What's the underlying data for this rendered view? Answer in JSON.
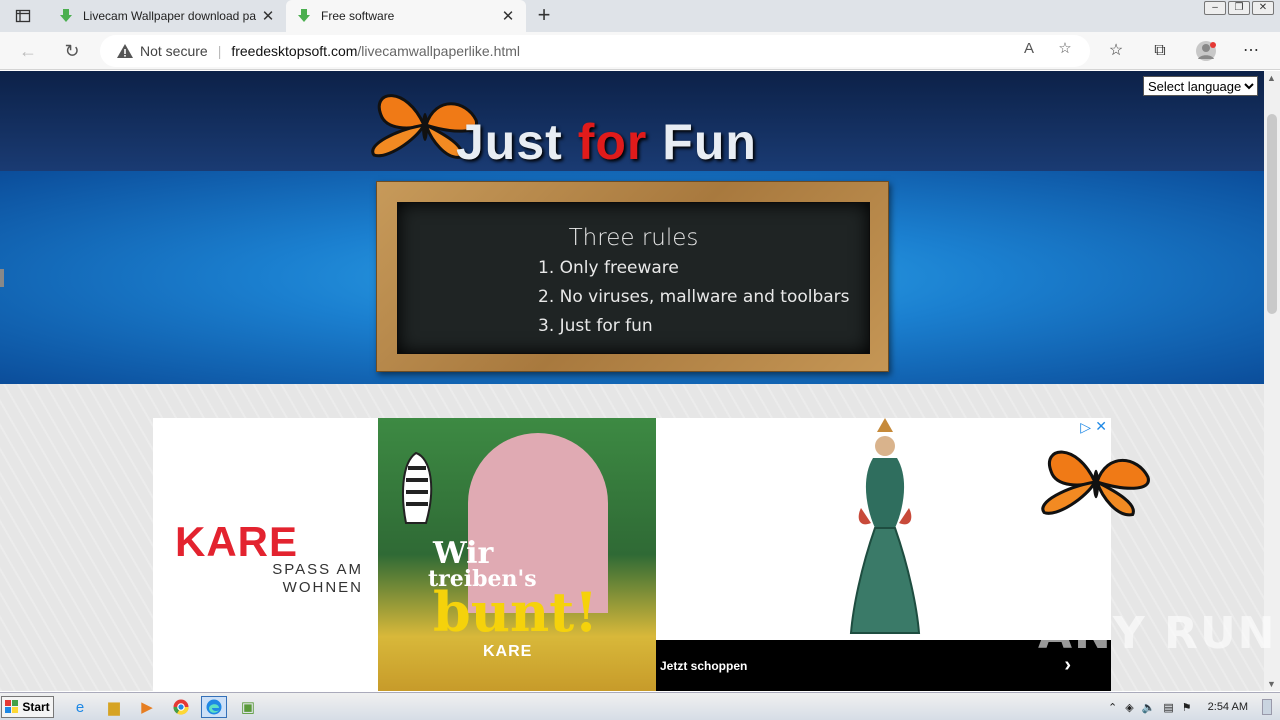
{
  "browser": {
    "tabs": [
      {
        "title": "Livecam Wallpaper download pa",
        "active": false
      },
      {
        "title": "Free software",
        "active": true
      }
    ],
    "address": {
      "security_label": "Not secure",
      "domain": "freedesktopsoft.com",
      "path": "/livecamwallpaperlike.html"
    }
  },
  "page": {
    "site_title_part1": "Just",
    "site_title_part2": "for",
    "site_title_part3": "Fun",
    "language_select": "Select language",
    "board": {
      "title": "Three rules",
      "rules": [
        "1. Only freeware",
        "2. No viruses, mallware and toolbars",
        "3. Just for fun"
      ]
    },
    "ad": {
      "brand": "KARE",
      "tagline_line1": "SPASS AM",
      "tagline_line2": "WOHNEN",
      "headline1": "Wir",
      "headline2": "treiben's",
      "headline3": "bunt!",
      "small_brand": "KARE",
      "cta": "Jetzt schoppen"
    }
  },
  "taskbar": {
    "start_label": "Start",
    "clock": "2:54 AM"
  },
  "watermark": "ANY RUN",
  "colors": {
    "accent_red": "#e01b1b",
    "kare_red": "#e3232f",
    "hero_blue": "#1b80d0",
    "link_blue": "#1e88e5"
  }
}
